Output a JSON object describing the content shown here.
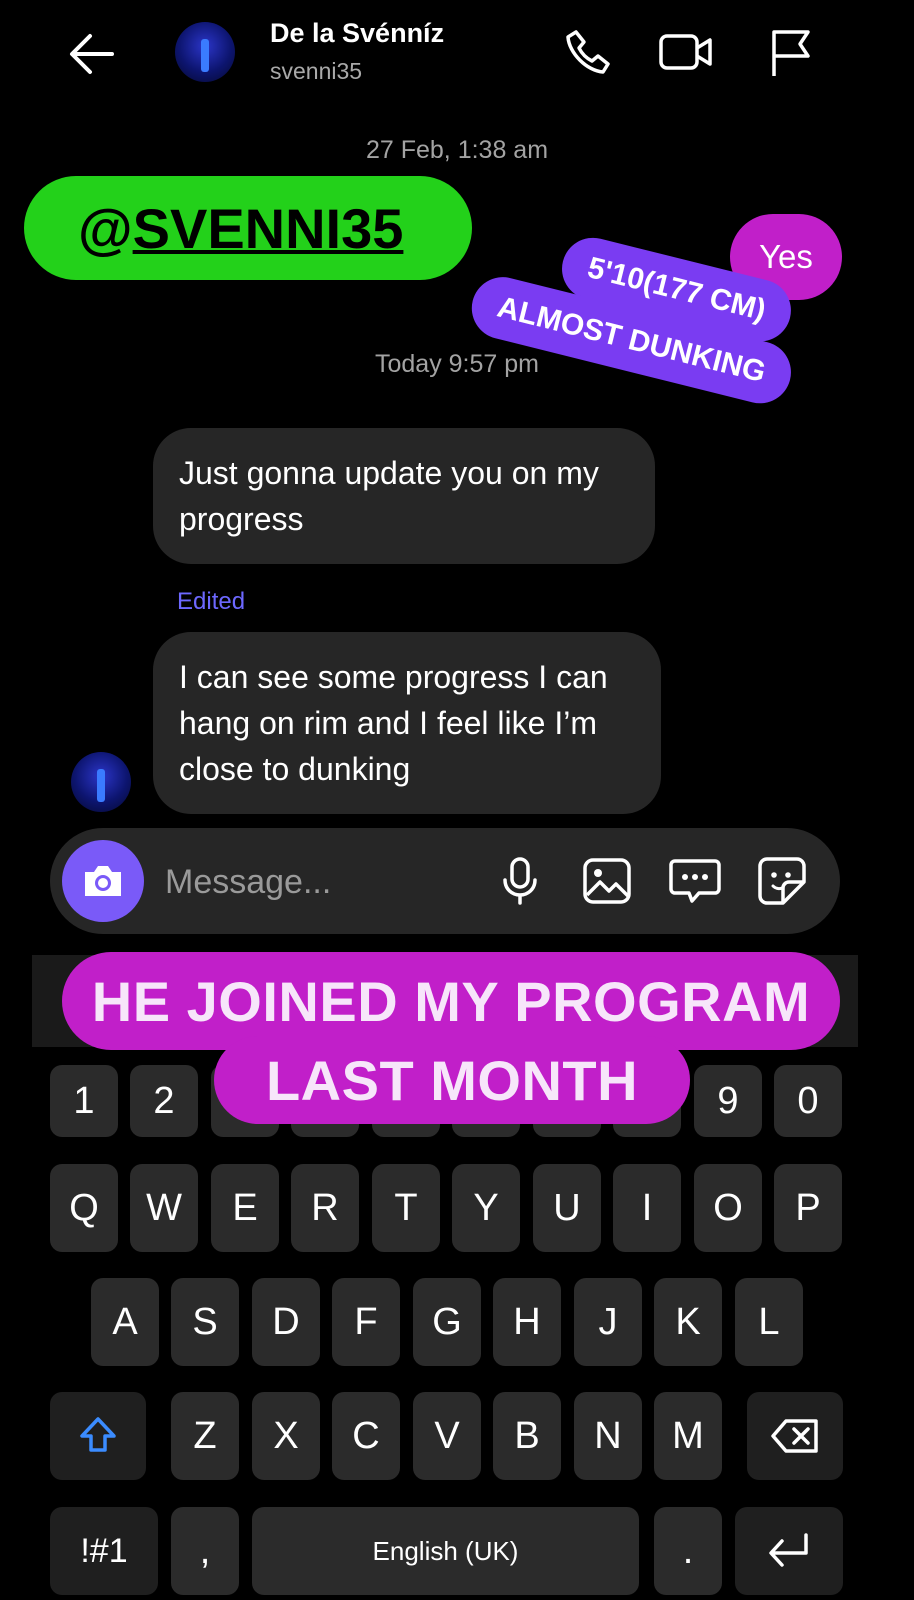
{
  "header": {
    "contact_name": "De la Svénníz",
    "username": "svenni35",
    "back_icon": "arrow-left-icon",
    "call_icon": "phone-icon",
    "video_icon": "video-camera-icon",
    "report_icon": "flag-icon"
  },
  "thread": {
    "timestamp_1": "27 Feb, 1:38 am",
    "timestamp_2": "Today 9:57 pm",
    "reply_yes": "Yes",
    "message_1": "Just gonna update you on my progress",
    "edited_label": "Edited",
    "message_2": "I can see some progress I can hang  on rim and I feel like I’m close to dunking"
  },
  "overlays": {
    "mention_at": "@",
    "mention_handle": "SVENNI35",
    "height_line": "5'10(177 CM)",
    "dunk_line": "ALMOST DUNKING",
    "banner_line_1": "HE JOINED MY PROGRAM",
    "banner_line_2": "LAST MONTH"
  },
  "composer": {
    "placeholder": "Message...",
    "camera_icon": "camera-icon",
    "mic_icon": "microphone-icon",
    "gallery_icon": "image-icon",
    "chat_icon": "chat-bubble-icon",
    "sticker_icon": "sticker-icon"
  },
  "keyboard": {
    "numbers_visible": [
      "1",
      "2",
      "9",
      "0"
    ],
    "row_q": [
      "Q",
      "W",
      "E",
      "R",
      "T",
      "Y",
      "U",
      "I",
      "O",
      "P"
    ],
    "row_a": [
      "A",
      "S",
      "D",
      "F",
      "G",
      "H",
      "J",
      "K",
      "L"
    ],
    "row_z": [
      "Z",
      "X",
      "C",
      "V",
      "B",
      "N",
      "M"
    ],
    "symbols_key": "!#1",
    "comma_key": ",",
    "space_label": "English (UK)",
    "period_key": ".",
    "shift_icon": "shift-arrow-icon",
    "backspace_icon": "backspace-icon",
    "enter_icon": "enter-arrow-icon"
  },
  "colors": {
    "mention_sticker": "#23d11a",
    "height_sticker": "#7a3cf2",
    "banner": "#c11fc9",
    "edited_text": "#6d68ff",
    "camera_button": "#7a5af8"
  }
}
